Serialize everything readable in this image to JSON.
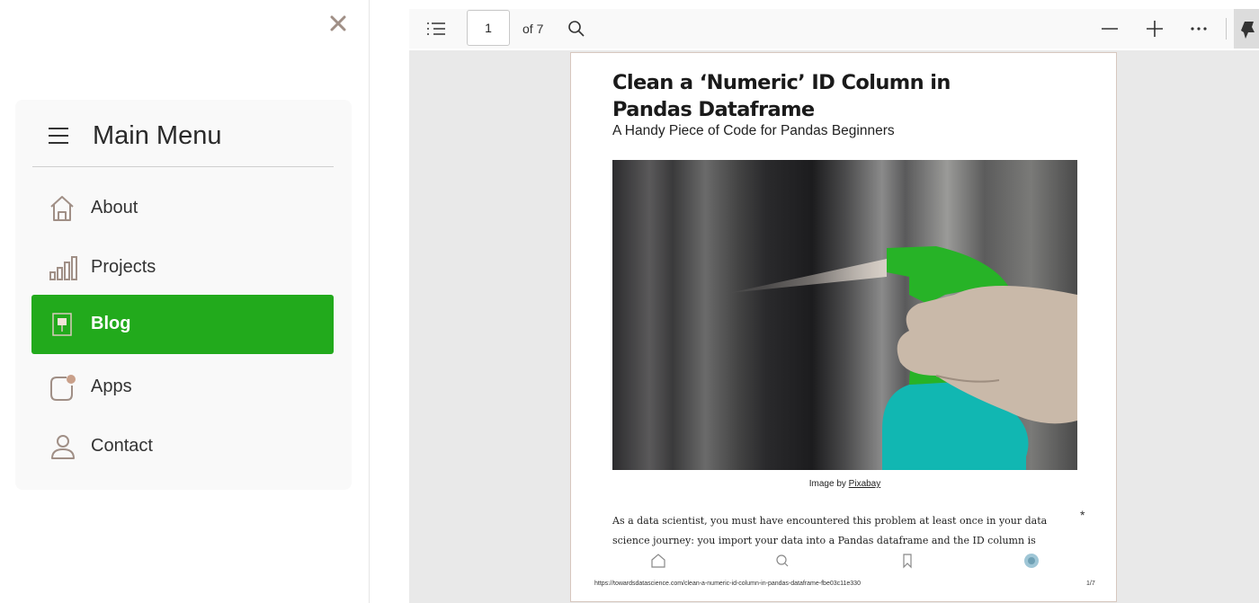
{
  "menu": {
    "title": "Main Menu",
    "items": [
      {
        "label": "About",
        "icon": "home-icon"
      },
      {
        "label": "Projects",
        "icon": "bar-chart-icon"
      },
      {
        "label": "Blog",
        "icon": "signboard-icon",
        "active": true
      },
      {
        "label": "Apps",
        "icon": "app-notification-icon"
      },
      {
        "label": "Contact",
        "icon": "user-icon"
      }
    ],
    "active_color": "#22aa1c"
  },
  "viewer": {
    "current_page": "1",
    "page_total_label": "of 7"
  },
  "document": {
    "title": "Clean a ‘Numeric’ ID Column in Pandas Dataframe",
    "subtitle": "A Handy Piece of Code for Pandas Beginners",
    "caption_prefix": "Image by",
    "caption_link": "Pixabay",
    "body_text": "As a data scientist, you must have encountered this problem at least once in your data science journey: you import your data into a Pandas dataframe and the ID column is",
    "asterisk": "*",
    "footer_url": "https://towardsdatascience.com/clean-a-numeric-id-column-in-pandas-dataframe-fbe03c11e330",
    "footer_page": "1/7"
  }
}
